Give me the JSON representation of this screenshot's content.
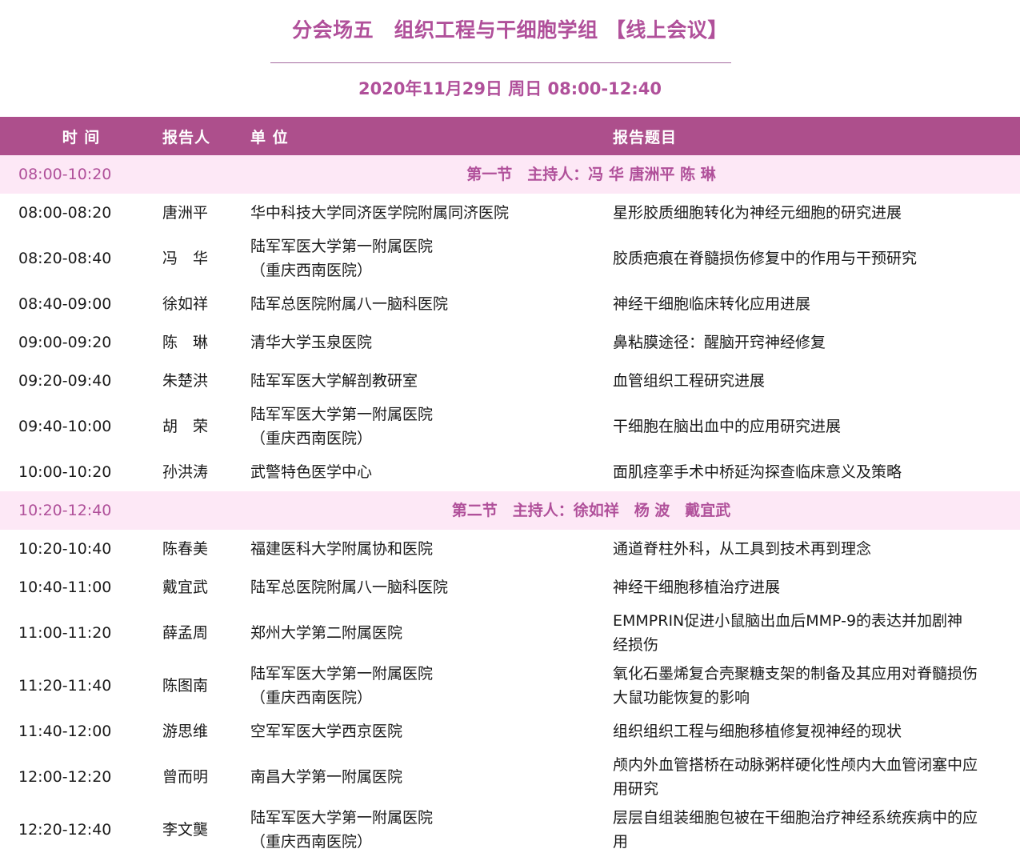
{
  "header": {
    "title": "分会场五　组织工程与干细胞学组 【线上会议】",
    "date": "2020年11月29日 周日 08:00-12:40"
  },
  "columns": {
    "time": "时 间",
    "speaker": "报告人",
    "unit": "单 位",
    "title": "报告题目"
  },
  "section1": {
    "time": "08:00-10:20",
    "label": "第一节　主持人：冯 华 唐洲平 陈 琳"
  },
  "section2": {
    "time": "10:20-12:40",
    "label": "第二节　主持人：徐如祥　杨 波　戴宜武"
  },
  "rows": [
    {
      "time": "08:00-08:20",
      "speaker": "唐洲平",
      "unit": [
        "华中科技大学同济医学院附属同济医院"
      ],
      "title": [
        "星形胶质细胞转化为神经元细胞的研究进展"
      ]
    },
    {
      "time": "08:20-08:40",
      "speaker": "冯　华",
      "unit": [
        "陆军军医大学第一附属医院",
        "（重庆西南医院）"
      ],
      "title": [
        "胶质疤痕在脊髓损伤修复中的作用与干预研究"
      ]
    },
    {
      "time": "08:40-09:00",
      "speaker": "徐如祥",
      "unit": [
        "陆军总医院附属八一脑科医院"
      ],
      "title": [
        "神经干细胞临床转化应用进展"
      ]
    },
    {
      "time": "09:00-09:20",
      "speaker": "陈　琳",
      "unit": [
        "清华大学玉泉医院"
      ],
      "title": [
        "鼻粘膜途径：醒脑开窍神经修复"
      ]
    },
    {
      "time": "09:20-09:40",
      "speaker": "朱楚洪",
      "unit": [
        "陆军军医大学解剖教研室"
      ],
      "title": [
        "血管组织工程研究进展"
      ]
    },
    {
      "time": "09:40-10:00",
      "speaker": "胡　荣",
      "unit": [
        "陆军军医大学第一附属医院",
        "（重庆西南医院）"
      ],
      "title": [
        "干细胞在脑出血中的应用研究进展"
      ]
    },
    {
      "time": "10:00-10:20",
      "speaker": "孙洪涛",
      "unit": [
        "武警特色医学中心"
      ],
      "title": [
        "面肌痉挛手术中桥延沟探查临床意义及策略"
      ]
    },
    {
      "time": "10:20-10:40",
      "speaker": "陈春美",
      "unit": [
        "福建医科大学附属协和医院"
      ],
      "title": [
        "通道脊柱外科，从工具到技术再到理念"
      ]
    },
    {
      "time": "10:40-11:00",
      "speaker": "戴宜武",
      "unit": [
        "陆军总医院附属八一脑科医院"
      ],
      "title": [
        "神经干细胞移植治疗进展"
      ]
    },
    {
      "time": "11:00-11:20",
      "speaker": "薛孟周",
      "unit": [
        "郑州大学第二附属医院"
      ],
      "title": [
        "EMMPRIN促进小鼠脑出血后MMP-9的表达并加剧神",
        "经损伤"
      ]
    },
    {
      "time": "11:20-11:40",
      "speaker": "陈图南",
      "unit": [
        "陆军军医大学第一附属医院",
        "（重庆西南医院）"
      ],
      "title": [
        "氧化石墨烯复合壳聚糖支架的制备及其应用对脊髓损伤",
        "大鼠功能恢复的影响"
      ]
    },
    {
      "time": "11:40-12:00",
      "speaker": "游思维",
      "unit": [
        "空军军医大学西京医院"
      ],
      "title": [
        "组织组织工程与细胞移植修复视神经的现状"
      ]
    },
    {
      "time": "12:00-12:20",
      "speaker": "曾而明",
      "unit": [
        "南昌大学第一附属医院"
      ],
      "title": [
        "颅内外血管搭桥在动脉粥样硬化性颅内大血管闭塞中应",
        "用研究"
      ]
    },
    {
      "time": "12:20-12:40",
      "speaker": "李文龑",
      "unit": [
        "陆军军医大学第一附属医院",
        "（重庆西南医院）"
      ],
      "title": [
        "层层自组装细胞包被在干细胞治疗神经系统疾病中的应",
        "用"
      ]
    }
  ]
}
